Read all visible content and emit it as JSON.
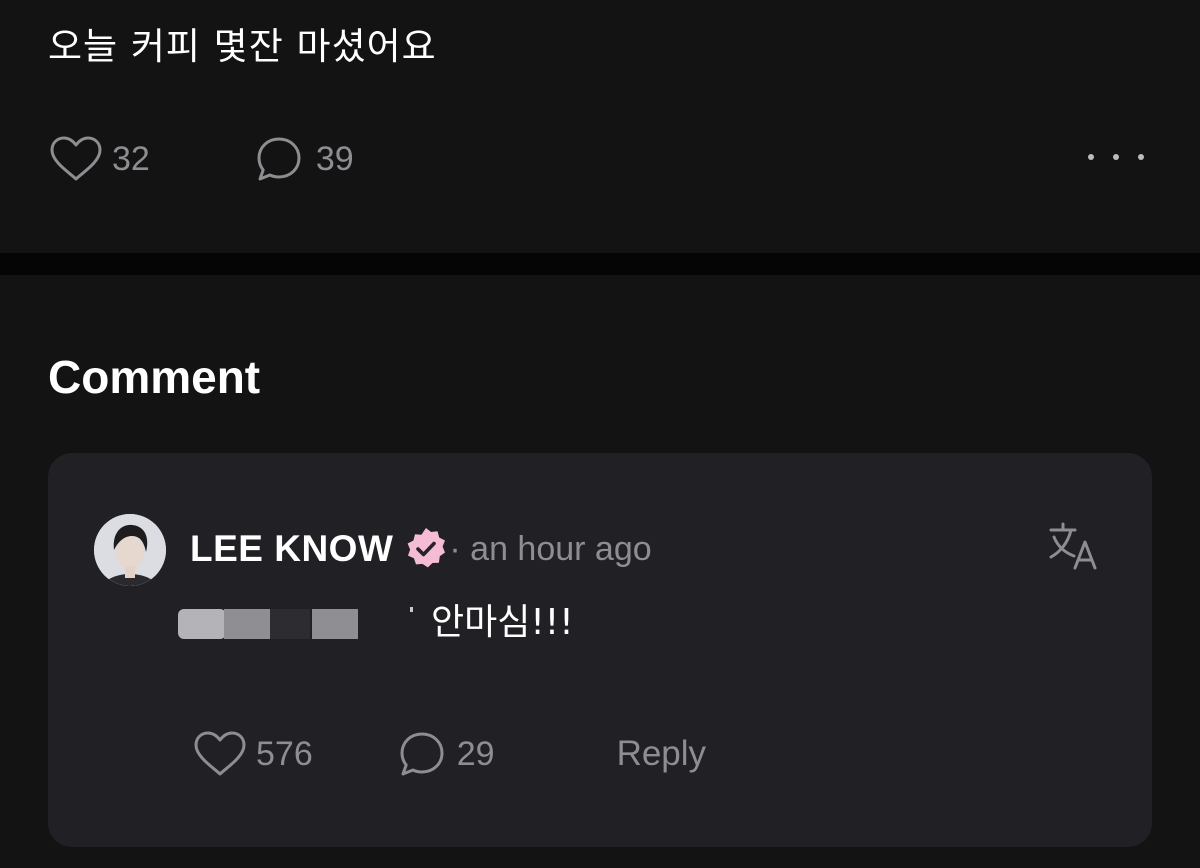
{
  "post": {
    "text": "오늘 커피 몇잔 마셨어요",
    "likes": "32",
    "comments": "39"
  },
  "comments_section": {
    "title": "Comment"
  },
  "comment": {
    "author": "LEE KNOW",
    "time": "· an hour ago",
    "text": "안마심!!!",
    "likes": "576",
    "replies": "29",
    "reply_label": "Reply"
  },
  "icons": {
    "like": "heart-outline-icon",
    "comment": "speech-bubble-icon",
    "more": "more-horizontal-icon",
    "verified": "verified-badge-icon",
    "translate": "translate-icon"
  },
  "colors": {
    "background": "#131314",
    "card": "#212024",
    "muted_text": "#8d8d92",
    "verified_badge": "#f5bcd6"
  }
}
